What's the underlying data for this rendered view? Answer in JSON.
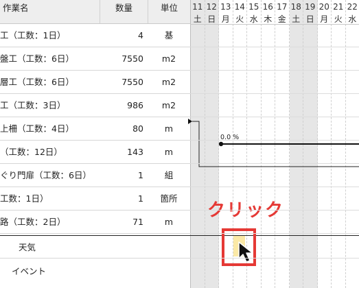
{
  "table": {
    "headers": {
      "name": "作業名",
      "qty": "数量",
      "unit": "単位"
    },
    "rows": [
      {
        "name": "工（工数：1日）",
        "qty": "4",
        "unit": "基"
      },
      {
        "name": "盤工（工数：6日）",
        "qty": "7550",
        "unit": "m2"
      },
      {
        "name": "層工（工数：6日）",
        "qty": "7550",
        "unit": "m2"
      },
      {
        "name": "工（工数：3日）",
        "qty": "986",
        "unit": "m2"
      },
      {
        "name": "上柵（工数：4日）",
        "qty": "80",
        "unit": "m"
      },
      {
        "name": "（工数：12日）",
        "qty": "143",
        "unit": "m"
      },
      {
        "name": "ぐり門扉（工数：6日）",
        "qty": "1",
        "unit": "組"
      },
      {
        "name": "工数：1日）",
        "qty": "1",
        "unit": "箇所"
      },
      {
        "name": "路（工数：2日）",
        "qty": "71",
        "unit": "m"
      }
    ]
  },
  "gantt": {
    "days": [
      {
        "day": "11",
        "weekday": "土",
        "weekend": true
      },
      {
        "day": "12",
        "weekday": "日",
        "weekend": true
      },
      {
        "day": "13",
        "weekday": "月",
        "weekend": false
      },
      {
        "day": "14",
        "weekday": "火",
        "weekend": false
      },
      {
        "day": "15",
        "weekday": "水",
        "weekend": false
      },
      {
        "day": "16",
        "weekday": "木",
        "weekend": false
      },
      {
        "day": "17",
        "weekday": "金",
        "weekend": false
      },
      {
        "day": "18",
        "weekday": "土",
        "weekend": true
      },
      {
        "day": "19",
        "weekday": "日",
        "weekend": true
      },
      {
        "day": "20",
        "weekday": "月",
        "weekend": false
      },
      {
        "day": "21",
        "weekday": "火",
        "weekend": false
      },
      {
        "day": "22",
        "weekday": "水",
        "weekend": false
      }
    ],
    "progress_label": "0.0 %"
  },
  "bottom": {
    "weather_label": "天気",
    "event_label": "イベント"
  },
  "annotation": {
    "label": "クリック",
    "color": "#e53935"
  },
  "colors": {
    "weekend": "#e6e6e6",
    "weather_cell": "#fbe9a6"
  }
}
